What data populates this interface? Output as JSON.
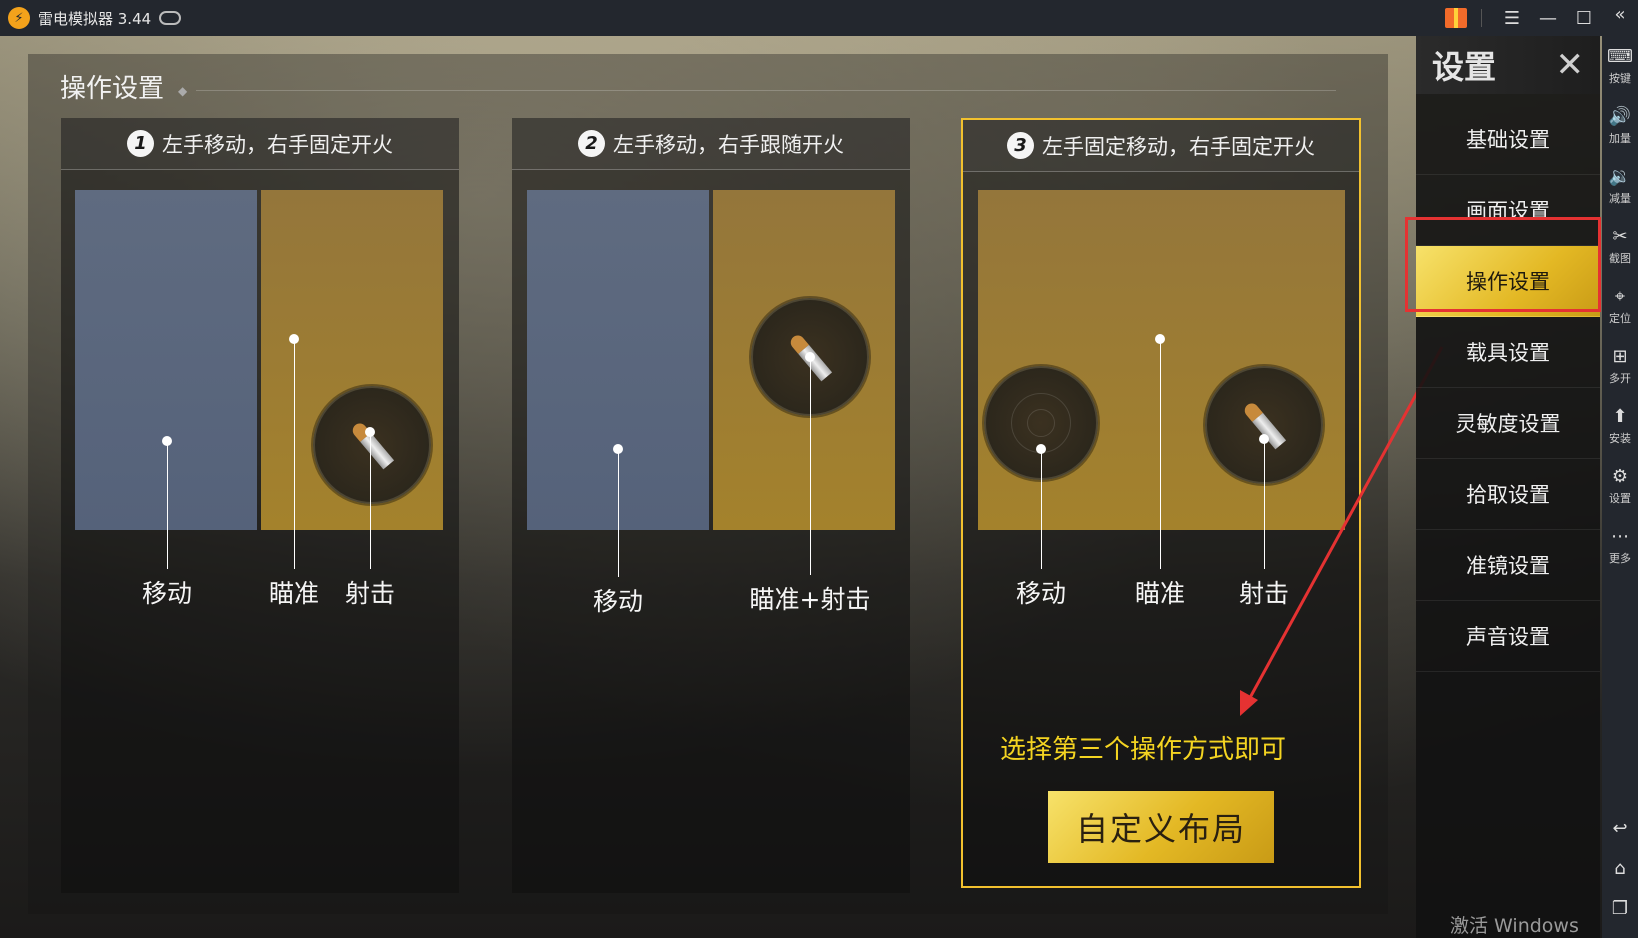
{
  "titlebar": {
    "title": "雷电模拟器 3.44"
  },
  "section": {
    "title": "操作设置"
  },
  "cards": [
    {
      "number": "1",
      "title": "左手移动，右手固定开火",
      "labels": [
        "移动",
        "瞄准",
        "射击"
      ]
    },
    {
      "number": "2",
      "title": "左手移动，右手跟随开火",
      "labels": [
        "移动",
        "瞄准+射击"
      ]
    },
    {
      "number": "3",
      "title": "左手固定移动，右手固定开火",
      "labels": [
        "移动",
        "瞄准",
        "射击"
      ]
    }
  ],
  "hint": "选择第三个操作方式即可",
  "custom_button": "自定义布局",
  "settings": {
    "title": "设置",
    "items": [
      "基础设置",
      "画面设置",
      "操作设置",
      "载具设置",
      "灵敏度设置",
      "拾取设置",
      "准镜设置",
      "声音设置"
    ],
    "active_index": 2
  },
  "tools": [
    "按键",
    "加量",
    "减量",
    "截图",
    "定位",
    "多开",
    "安装",
    "设置",
    "更多"
  ],
  "watermark": "激活 Windows",
  "colors": {
    "accent": "#f2c12e",
    "highlight_box": "#e53232",
    "hint": "#f4d421"
  }
}
